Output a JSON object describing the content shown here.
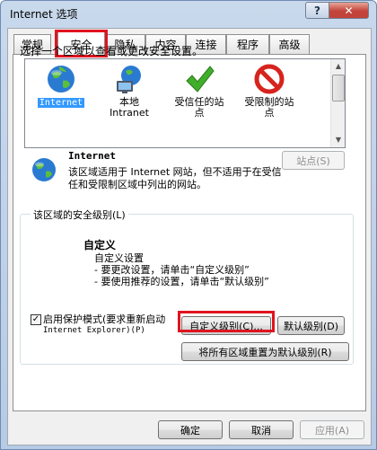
{
  "window": {
    "title": "Internet 选项",
    "help_label": "?",
    "close_label": "✕"
  },
  "tabs": [
    {
      "label": "常规"
    },
    {
      "label": "安全"
    },
    {
      "label": "隐私"
    },
    {
      "label": "内容"
    },
    {
      "label": "连接"
    },
    {
      "label": "程序"
    },
    {
      "label": "高级"
    }
  ],
  "active_tab": "安全",
  "security": {
    "zones_prompt": "选择一个区域以查看或更改安全设置。",
    "zones": [
      {
        "label": "Internet",
        "icon": "globe-icon",
        "selected": true
      },
      {
        "label": "本地\nIntranet",
        "icon": "intranet-icon",
        "selected": false
      },
      {
        "label": "受信任的站\n点",
        "icon": "check-icon",
        "selected": false
      },
      {
        "label": "受限制的站\n点",
        "icon": "forbidden-icon",
        "selected": false
      }
    ],
    "zone_name": "Internet",
    "zone_description": "该区域适用于 Internet 网站，但不适用于在受信任和受限制区域中列出的网站。",
    "sites_button": "站点(S)",
    "level_group_label": "该区域的安全级别(L)",
    "level_title": "自定义",
    "level_description": "自定义设置\n- 要更改设置，请单击“自定义级别”\n- 要使用推荐的设置，请单击“默认级别”",
    "protected_mode_label_1": "启用保护模式(要求重新启动",
    "protected_mode_label_2": "Internet Explorer)(P)",
    "protected_mode_checked": true,
    "custom_level_button": "自定义级别(C)...",
    "default_level_button": "默认级别(D)",
    "reset_all_button": "将所有区域重置为默认级别(R)"
  },
  "footer": {
    "ok": "确定",
    "cancel": "取消",
    "apply": "应用(A)"
  },
  "colors": {
    "highlight": "#e0141f",
    "selection": "#3399ff"
  }
}
